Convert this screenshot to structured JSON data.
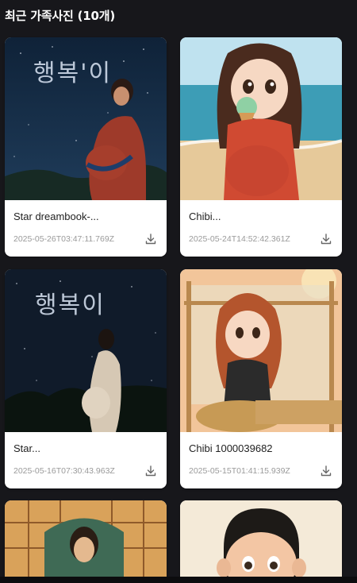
{
  "header": {
    "title": "최근 가족사진 (10개)"
  },
  "photos": [
    {
      "title": "Star dreambook-...",
      "date": "2025-05-26T03:47:11.769Z",
      "image": "pregnant woman under starry night sky",
      "overlay_text": "행복'이"
    },
    {
      "title": "Chibi...",
      "date": "2025-05-24T14:52:42.361Z",
      "image": "chibi pregnant girl eating ice cream at beach"
    },
    {
      "title": "Star...",
      "date": "2025-05-16T07:30:43.963Z",
      "image": "pregnant woman silhouette under stars",
      "overlay_text": "행복이"
    },
    {
      "title": "Chibi 1000039682",
      "date": "2025-05-15T01:41:15.939Z",
      "image": "chibi girl sitting on woven basket"
    },
    {
      "image": "illustrated woman in stained glass window"
    },
    {
      "image": "chibi boy portrait"
    }
  ],
  "icons": {
    "download": "download-icon"
  }
}
